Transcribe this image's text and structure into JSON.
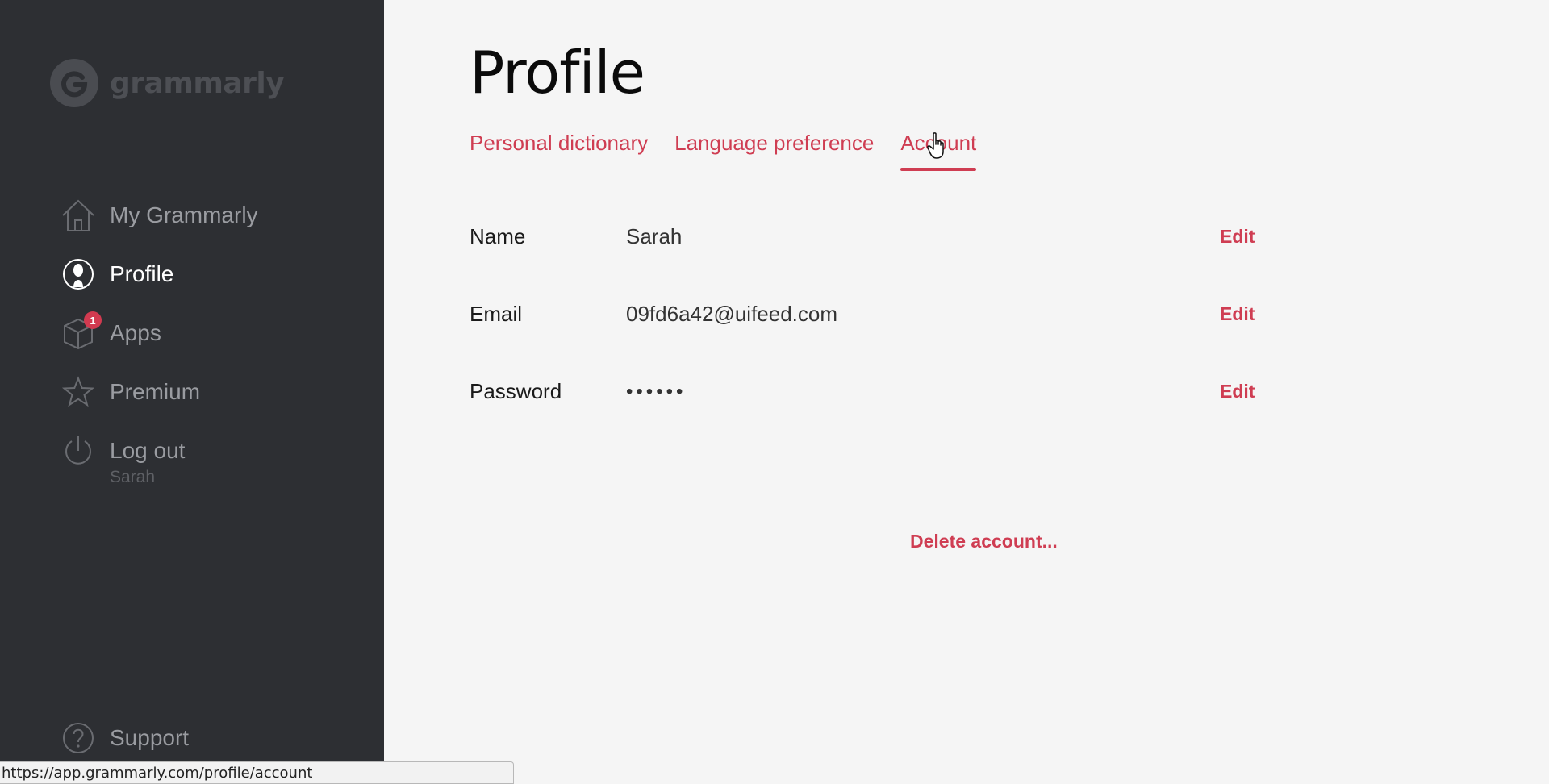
{
  "sidebar": {
    "logo_text": "grammarly",
    "items": [
      {
        "label": "My Grammarly",
        "icon": "home-icon"
      },
      {
        "label": "Profile",
        "icon": "user-icon"
      },
      {
        "label": "Apps",
        "icon": "box-icon",
        "badge": "1"
      },
      {
        "label": "Premium",
        "icon": "star-icon"
      },
      {
        "label": "Log out",
        "icon": "power-icon",
        "sub": "Sarah"
      }
    ],
    "support_label": "Support"
  },
  "status_bar": {
    "url": "https://app.grammarly.com/profile/account"
  },
  "main": {
    "title": "Profile",
    "tabs": [
      {
        "label": "Personal dictionary"
      },
      {
        "label": "Language preference"
      },
      {
        "label": "Account"
      }
    ],
    "fields": [
      {
        "label": "Name",
        "value": "Sarah",
        "edit": "Edit"
      },
      {
        "label": "Email",
        "value": "09fd6a42@uifeed.com",
        "edit": "Edit"
      },
      {
        "label": "Password",
        "value": "••••••",
        "edit": "Edit"
      }
    ],
    "delete_label": "Delete account..."
  },
  "colors": {
    "accent": "#cf3d52",
    "sidebar_bg": "#2d2f33",
    "main_bg": "#f5f5f5"
  }
}
